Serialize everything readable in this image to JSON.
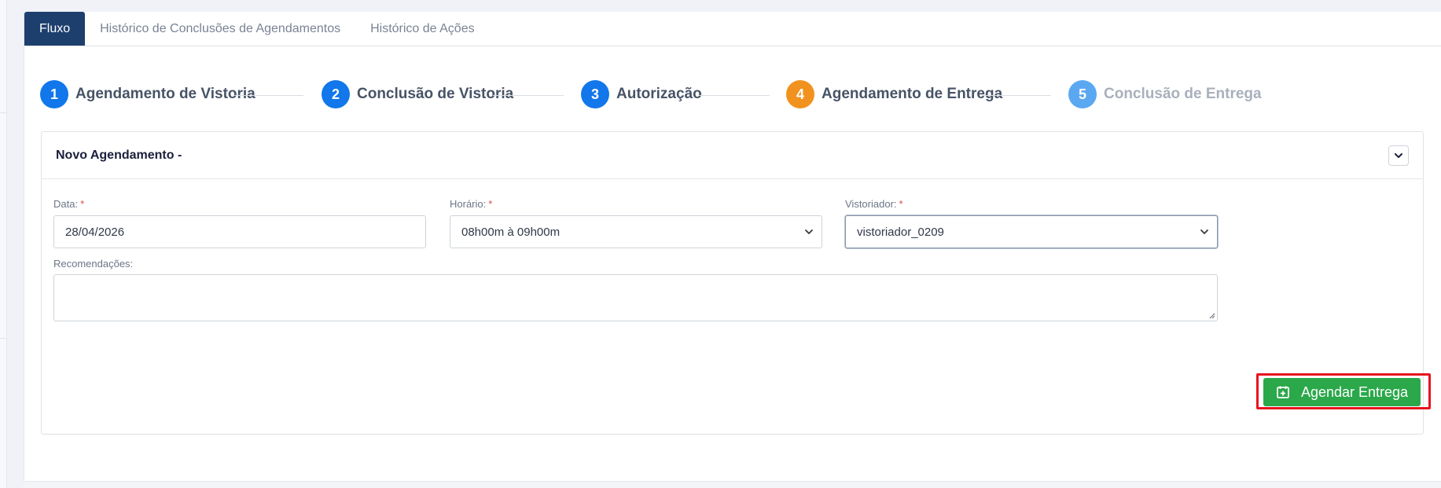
{
  "tabs": [
    {
      "label": "Fluxo",
      "active": true
    },
    {
      "label": "Histórico de Conclusões de Agendamentos",
      "active": false
    },
    {
      "label": "Histórico de Ações",
      "active": false
    }
  ],
  "steps": [
    {
      "number": "1",
      "label": "Agendamento de Vistoria",
      "state": "done"
    },
    {
      "number": "2",
      "label": "Conclusão de Vistoria",
      "state": "done"
    },
    {
      "number": "3",
      "label": "Autorização",
      "state": "done"
    },
    {
      "number": "4",
      "label": "Agendamento de Entrega",
      "state": "current"
    },
    {
      "number": "5",
      "label": "Conclusão de Entrega",
      "state": "future"
    }
  ],
  "card": {
    "title": "Novo Agendamento -",
    "collapse_icon": "chevron-down-icon"
  },
  "form": {
    "date": {
      "label": "Data:",
      "required_mark": "*",
      "value": "28/04/2026"
    },
    "time": {
      "label": "Horário:",
      "required_mark": "*",
      "value": "08h00m à 09h00m"
    },
    "inspector": {
      "label": "Vistoriador:",
      "required_mark": "*",
      "value": "vistoriador_0209"
    },
    "recommendations": {
      "label": "Recomendações:",
      "value": ""
    }
  },
  "actions": {
    "schedule_label": "Agendar Entrega",
    "schedule_icon": "calendar-plus-icon"
  },
  "colors": {
    "tab_active": "#1d3f6e",
    "step_done": "#1177ea",
    "step_current": "#f2921e",
    "step_future": "#5ba8f2",
    "primary_button": "#2ba84a",
    "highlight": "#e8141e"
  }
}
